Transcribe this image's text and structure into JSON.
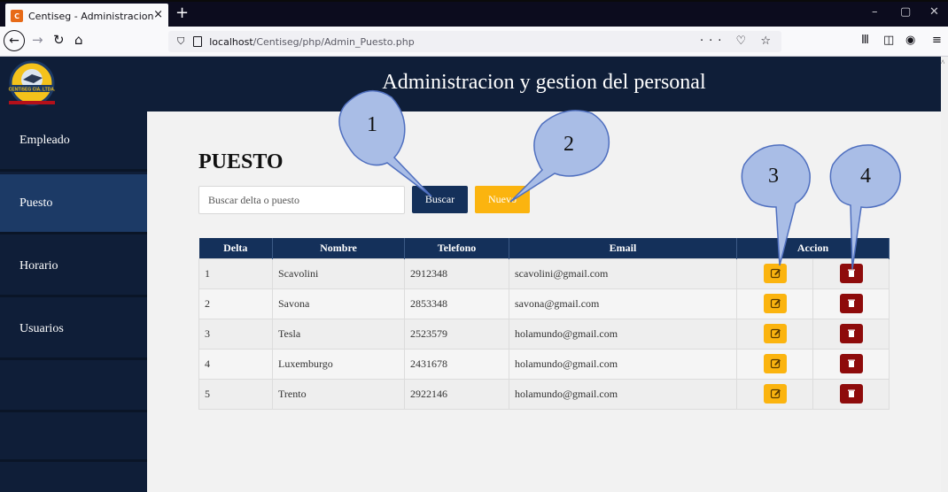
{
  "browser": {
    "tab_title": "Centiseg - Administracion",
    "tab_close": "×",
    "new_tab": "+",
    "url_host": "localhost",
    "url_path": "/Centiseg/php/Admin_Puesto.php",
    "url_actions": "··· ♡ ☆",
    "window_controls": {
      "minimize": "–",
      "maximize": "▢",
      "close": "✕"
    }
  },
  "app": {
    "header_title": "Administracion y gestion del personal",
    "logo_text": "CENTISEG CIA. LTDA."
  },
  "sidebar": {
    "items": [
      {
        "label": "Empleado",
        "active": false
      },
      {
        "label": "Puesto",
        "active": true
      },
      {
        "label": "Horario",
        "active": false
      },
      {
        "label": "Usuarios",
        "active": false
      }
    ]
  },
  "main": {
    "page_title": "PUESTO",
    "search_placeholder": "Buscar delta o puesto",
    "buscar_label": "Buscar",
    "nuevo_label": "Nuevo"
  },
  "table": {
    "headers": [
      "Delta",
      "Nombre",
      "Telefono",
      "Email",
      "Accion"
    ],
    "rows": [
      {
        "delta": "1",
        "nombre": "Scavolini",
        "telefono": "2912348",
        "email": "scavolini@gmail.com"
      },
      {
        "delta": "2",
        "nombre": "Savona",
        "telefono": "2853348",
        "email": "savona@gmail.com"
      },
      {
        "delta": "3",
        "nombre": "Tesla",
        "telefono": "2523579",
        "email": "holamundo@gmail.com"
      },
      {
        "delta": "4",
        "nombre": "Luxemburgo",
        "telefono": "2431678",
        "email": "holamundo@gmail.com"
      },
      {
        "delta": "5",
        "nombre": "Trento",
        "telefono": "2922146",
        "email": "holamundo@gmail.com"
      }
    ]
  },
  "callouts": [
    "1",
    "2",
    "3",
    "4"
  ],
  "colors": {
    "navy": "#0f1e38",
    "active_nav": "#1c3a66",
    "table_header": "#14305a",
    "edit_yellow": "#fbb40f",
    "delete_red": "#8e0b0b",
    "callout_fill": "#a9bde6"
  },
  "icons": {
    "edit": "edit-icon",
    "delete": "trash-icon"
  }
}
